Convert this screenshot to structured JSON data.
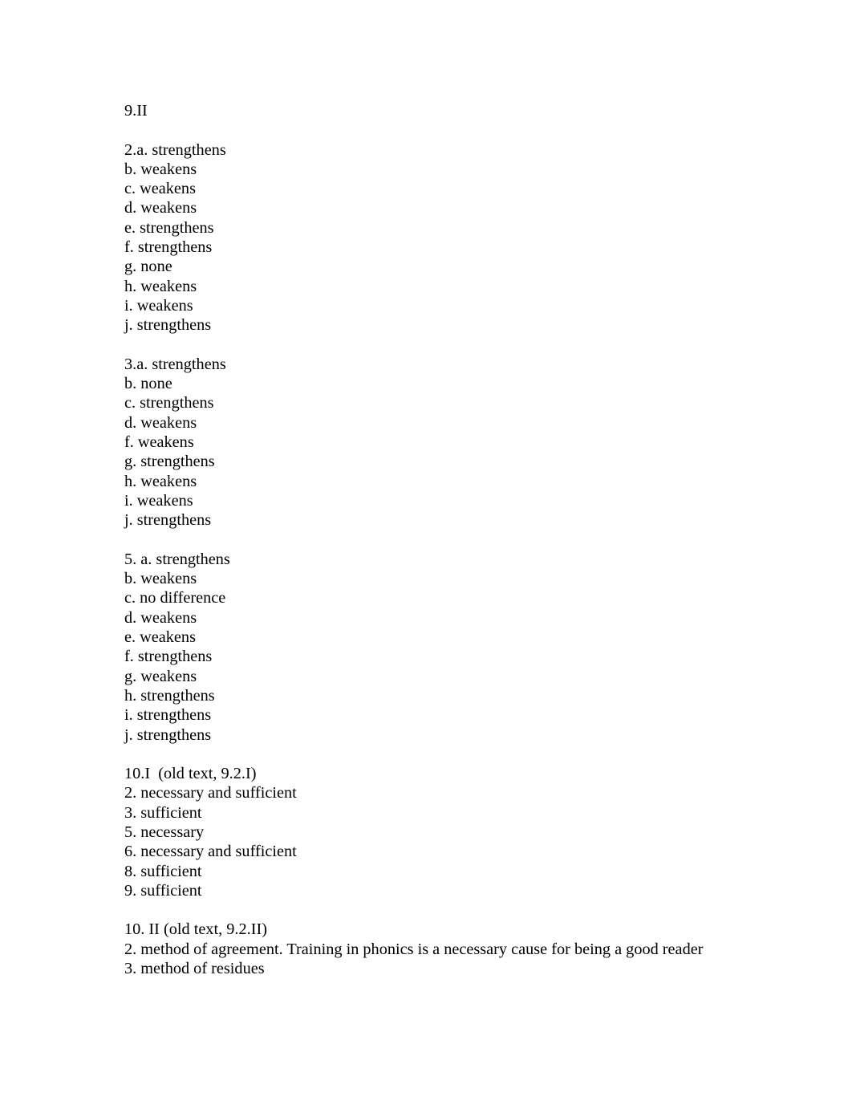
{
  "document": {
    "title": "9.II",
    "blocks": [
      {
        "id": "heading-9-II",
        "lines": [
          "9.II"
        ]
      },
      {
        "id": "exercise-2",
        "lines": [
          "2.a. strengthens",
          "b. weakens",
          "c. weakens",
          "d. weakens",
          "e. strengthens",
          "f. strengthens",
          "g. none",
          "h. weakens",
          "i. weakens",
          "j. strengthens"
        ]
      },
      {
        "id": "exercise-3",
        "lines": [
          "3.a. strengthens",
          "b. none",
          "c. strengthens",
          "d. weakens",
          "f. weakens",
          "g. strengthens",
          "h. weakens",
          "i. weakens",
          "j. strengthens"
        ]
      },
      {
        "id": "exercise-5",
        "lines": [
          "5. a. strengthens",
          "b. weakens",
          "c. no difference",
          "d. weakens",
          "e. weakens",
          "f. strengthens",
          "g. weakens",
          "h. strengthens",
          "i. strengthens",
          "j. strengthens"
        ]
      },
      {
        "id": "exercise-10-I",
        "lines": [
          "10.I  (old text, 9.2.I)",
          "2. necessary and sufficient",
          "3. sufficient",
          "5. necessary",
          "6. necessary and sufficient",
          "8. sufficient",
          "9. sufficient"
        ]
      },
      {
        "id": "exercise-10-II",
        "lines": [
          "10. II (old text, 9.2.II)",
          "2. method of agreement. Training in phonics is a necessary cause for being a good reader",
          "3. method of residues"
        ]
      }
    ]
  },
  "colors": {
    "page_background": "#ffffff",
    "text": "#000000"
  }
}
